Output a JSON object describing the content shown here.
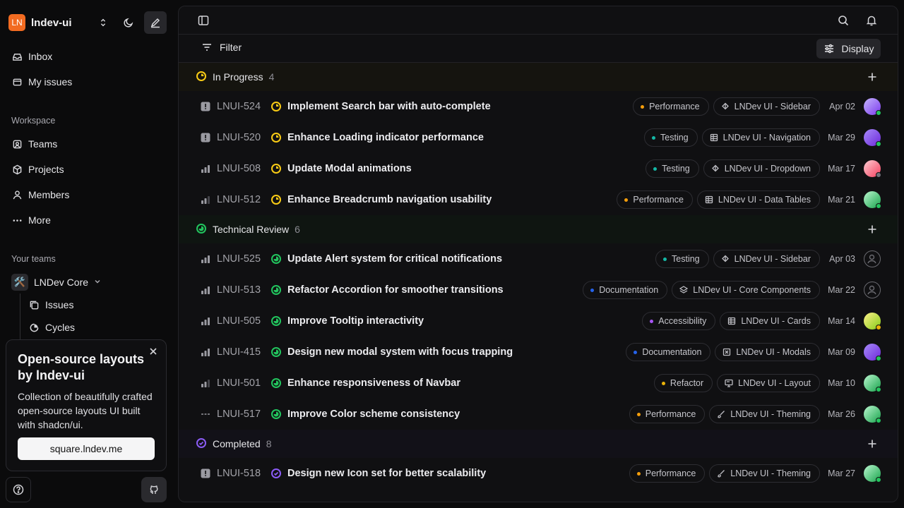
{
  "workspace": {
    "logo": "LN",
    "name": "lndev-ui"
  },
  "nav": {
    "inbox": "Inbox",
    "my_issues": "My issues"
  },
  "workspace_section": {
    "label": "Workspace",
    "items": [
      "Teams",
      "Projects",
      "Members",
      "More"
    ]
  },
  "teams_section": {
    "label": "Your teams",
    "team_emoji": "🛠️",
    "team_name": "LNDev Core",
    "sub_items": [
      "Issues",
      "Cycles"
    ]
  },
  "promo": {
    "title": "Open-source layouts by lndev-ui",
    "description": "Collection of beautifully crafted open-source layouts UI built with shadcn/ui.",
    "button": "square.lndev.me"
  },
  "toolbar": {
    "filter": "Filter",
    "display": "Display"
  },
  "colors": {
    "in_progress": "#facc15",
    "technical_review": "#22c55e",
    "completed": "#8b5cf6",
    "Performance": "#f59e0b",
    "Testing": "#14b8a6",
    "Documentation": "#2563eb",
    "Accessibility": "#a855f7",
    "Refactor": "#eab308",
    "Design": "#ec4899"
  },
  "groups": [
    {
      "key": "in_progress",
      "name": "In Progress",
      "count": "4",
      "issues": [
        {
          "prio": "urgent",
          "id": "LNUI-524",
          "title": "Implement Search bar with auto-complete",
          "label": "Performance",
          "project": "LNDev UI - Sidebar",
          "project_icon": "sidebar-icon",
          "date": "Apr 02",
          "avatar": "purple",
          "status": "green"
        },
        {
          "prio": "urgent",
          "id": "LNUI-520",
          "title": "Enhance Loading indicator performance",
          "label": "Testing",
          "project": "LNDev UI - Navigation",
          "project_icon": "table-icon",
          "date": "Mar 29",
          "avatar": "violet",
          "status": "green"
        },
        {
          "prio": "high",
          "id": "LNUI-508",
          "title": "Update Modal animations",
          "label": "Testing",
          "project": "LNDev UI - Dropdown",
          "project_icon": "sidebar-icon",
          "date": "Mar 17",
          "avatar": "pink",
          "status": "gray"
        },
        {
          "prio": "medium",
          "id": "LNUI-512",
          "title": "Enhance Breadcrumb navigation usability",
          "label": "Performance",
          "project": "LNDev UI - Data Tables",
          "project_icon": "table-icon",
          "date": "Mar 21",
          "avatar": "green",
          "status": "green"
        }
      ]
    },
    {
      "key": "technical_review",
      "name": "Technical Review",
      "count": "6",
      "issues": [
        {
          "prio": "high",
          "id": "LNUI-525",
          "title": "Update Alert system for critical notifications",
          "label": "Testing",
          "project": "LNDev UI - Sidebar",
          "project_icon": "sidebar-icon",
          "date": "Apr 03",
          "avatar": "empty",
          "status": ""
        },
        {
          "prio": "high",
          "id": "LNUI-513",
          "title": "Refactor Accordion for smoother transitions",
          "label": "Documentation",
          "project": "LNDev UI - Core Components",
          "project_icon": "component-icon",
          "date": "Mar 22",
          "avatar": "empty",
          "status": ""
        },
        {
          "prio": "high",
          "id": "LNUI-505",
          "title": "Improve Tooltip interactivity",
          "label": "Accessibility",
          "project": "LNDev UI - Cards",
          "project_icon": "table-icon",
          "date": "Mar 14",
          "avatar": "yellow",
          "status": "yellow"
        },
        {
          "prio": "high",
          "id": "LNUI-415",
          "title": "Design new modal system with focus trapping",
          "label": "Documentation",
          "project": "LNDev UI - Modals",
          "project_icon": "modal-icon",
          "date": "Mar 09",
          "avatar": "violet",
          "status": "green"
        },
        {
          "prio": "medium",
          "id": "LNUI-501",
          "title": "Enhance responsiveness of Navbar",
          "label": "Refactor",
          "project": "LNDev UI - Layout",
          "project_icon": "layout-icon",
          "date": "Mar 10",
          "avatar": "green",
          "status": "green"
        },
        {
          "prio": "none",
          "id": "LNUI-517",
          "title": "Improve Color scheme consistency",
          "label": "Performance",
          "project": "LNDev UI - Theming",
          "project_icon": "brush-icon",
          "date": "Mar 26",
          "avatar": "green",
          "status": "green"
        }
      ]
    },
    {
      "key": "completed",
      "name": "Completed",
      "count": "8",
      "issues": [
        {
          "prio": "urgent",
          "id": "LNUI-518",
          "title": "Design new Icon set for better scalability",
          "label": "Performance",
          "project": "LNDev UI - Theming",
          "project_icon": "brush-icon",
          "date": "Mar 27",
          "avatar": "green",
          "status": "green"
        }
      ]
    }
  ]
}
